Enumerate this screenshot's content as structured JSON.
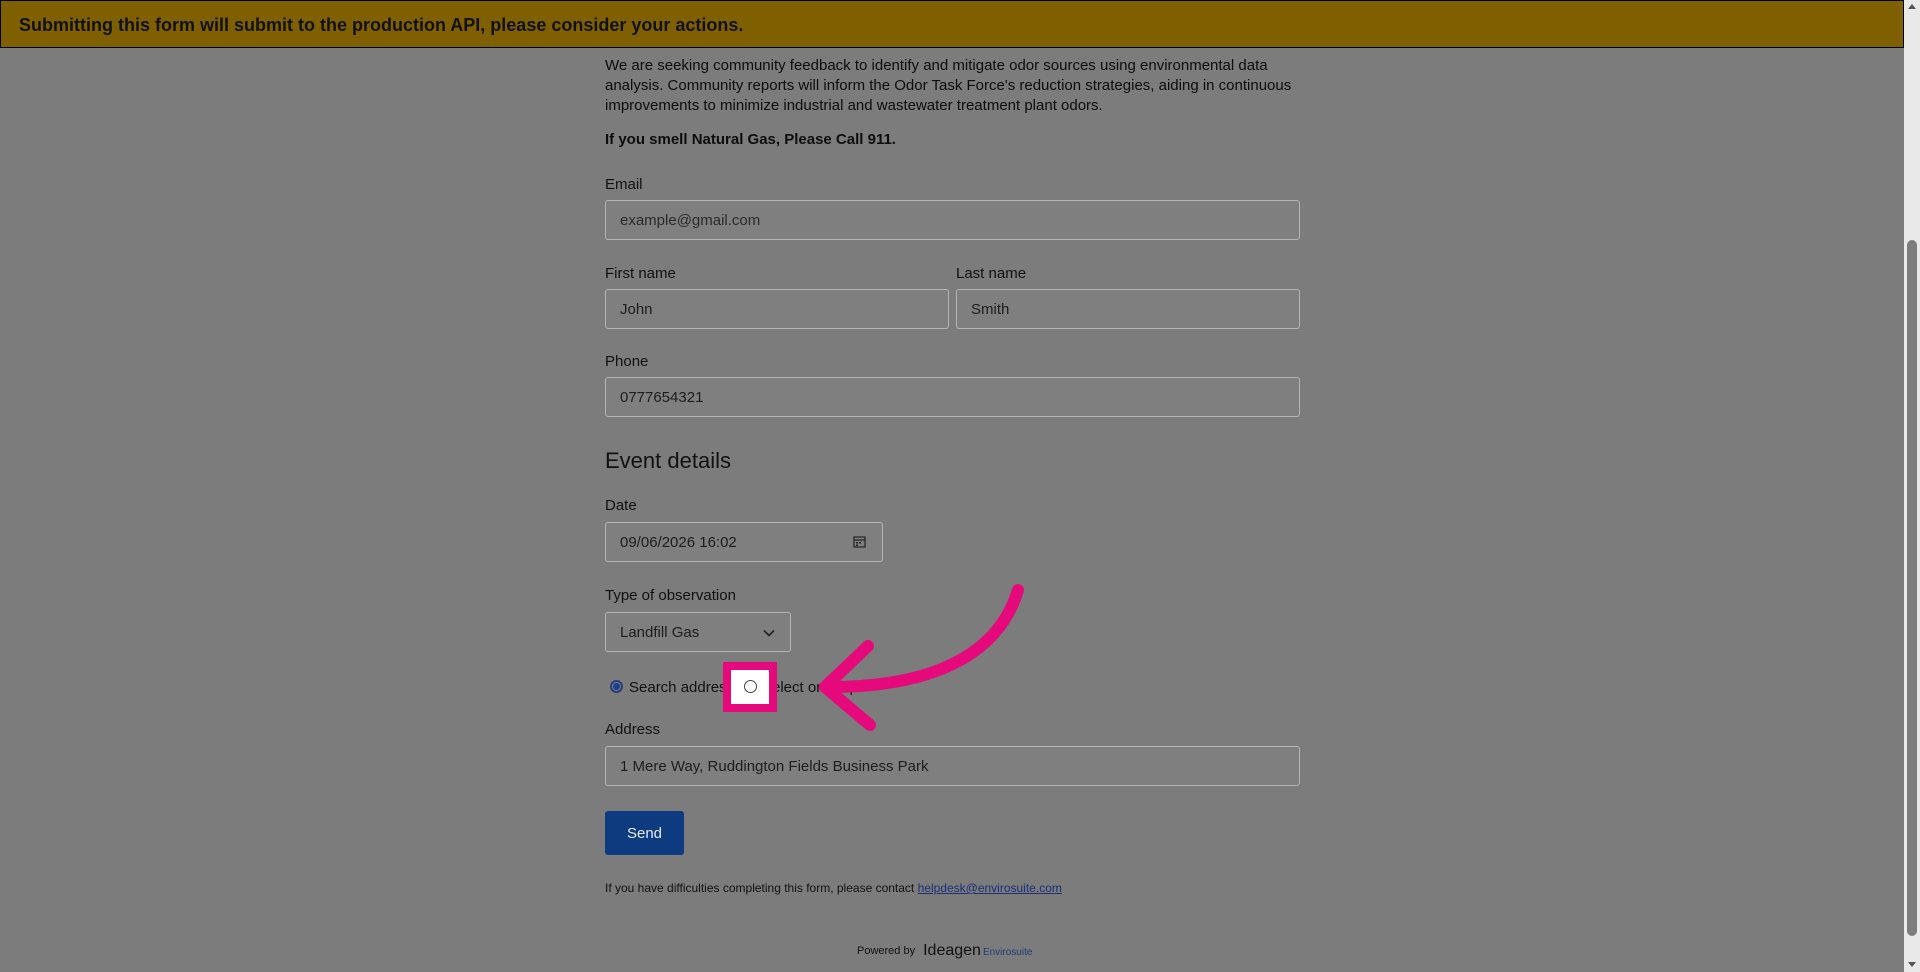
{
  "banner": {
    "text": "Submitting this form will submit to the production API, please consider your actions."
  },
  "intro": {
    "paragraph": "We are seeking community feedback to identify and mitigate odor sources using environmental data analysis. Community reports will inform the Odor Task Force's reduction strategies, aiding in continuous improvements to minimize industrial and wastewater treatment plant odors.",
    "warning": "If you smell Natural Gas, Please Call 911."
  },
  "fields": {
    "email_label": "Email",
    "email_placeholder": "example@gmail.com",
    "first_name_label": "First name",
    "first_name_value": "John",
    "last_name_label": "Last name",
    "last_name_value": "Smith",
    "phone_label": "Phone",
    "phone_value": "0777654321"
  },
  "event": {
    "heading": "Event details",
    "date_label": "Date",
    "date_value": "09/06/2026 16:02",
    "type_label": "Type of observation",
    "type_value": "Landfill Gas",
    "radio_search": "Search address",
    "radio_select": "Select on map",
    "radio_selected": "search",
    "address_label": "Address",
    "address_value": "1 Mere Way, Ruddington Fields Business Park"
  },
  "actions": {
    "send_label": "Send"
  },
  "footer": {
    "help_text": "If you have difficulties completing this form, please contact ",
    "help_email": "helpdesk@envirosuite.com",
    "powered_by": "Powered by",
    "logo_main": "Ideagen",
    "logo_sub": "Envirosuite"
  },
  "annotation": {
    "color": "#e6097b"
  },
  "colors": {
    "banner_bg": "#7f6000",
    "send_bg": "#0e3b80",
    "overlay_bg": "#7c7c7c"
  }
}
